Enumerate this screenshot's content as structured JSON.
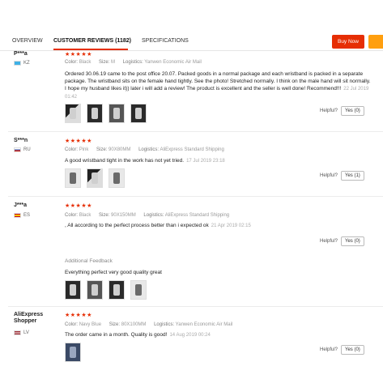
{
  "tabs": [
    {
      "label": "OVERVIEW"
    },
    {
      "label": "CUSTOMER REVIEWS (1182)"
    },
    {
      "label": "SPECIFICATIONS"
    }
  ],
  "buy_now_label": "Buy Now",
  "colors": {
    "accent": "#e62e04",
    "secondary": "#ff9f0f"
  },
  "stars": "★★★★★",
  "helpful_label": "Helpful?",
  "reviews": [
    {
      "name": "P***a",
      "country": "KZ",
      "meta": {
        "color_label": "Color:",
        "color": "Black",
        "size_label": "Size:",
        "size": "M",
        "logistics_label": "Logistics:",
        "logistics": "Yanwen Economic Air Mail"
      },
      "text": "Ordered 30.06.19 came to the post office 20.07. Packed goods in a normal package and each wristband is packed in a separate package. The wristband sits on the female hand tightly. See the photo! Stretched normally. I think on the male hand will sit normally. I hope my husband likes it)) later i will add a review! The product is excellent and the seller is well done! Recommend!!!",
      "date": "22 Jul 2019 01:42",
      "yes": "Yes (0)"
    },
    {
      "name": "S***n",
      "country": "RU",
      "meta": {
        "color_label": "Color:",
        "color": "Pink",
        "size_label": "Size:",
        "size": "90X80MM",
        "logistics_label": "Logistics:",
        "logistics": "AliExpress Standard Shipping"
      },
      "text": "A good wristband tight in the work has not yet tried.",
      "date": "17 Jul 2019 23:18",
      "yes": "Yes (1)"
    },
    {
      "name": "J***a",
      "country": "ES",
      "meta": {
        "color_label": "Color:",
        "color": "Black",
        "size_label": "Size:",
        "size": "90X150MM",
        "logistics_label": "Logistics:",
        "logistics": "AliExpress Standard Shipping"
      },
      "text": ", All according to the perfect process better than i expected ok",
      "date": "21 Apr 2019 02:15",
      "yes": "Yes (0)",
      "additional_label": "Additional Feedback",
      "additional_text": "Everything perfect very good quality great"
    },
    {
      "name": "AliExpress Shopper",
      "country": "LV",
      "meta": {
        "color_label": "Color:",
        "color": "Navy Blue",
        "size_label": "Size:",
        "size": "80X100MM",
        "logistics_label": "Logistics:",
        "logistics": "Yanwen Economic Air Mail"
      },
      "text": "The order came in a month. Quality is good!",
      "date": "14 Aug 2019 00:24",
      "yes": "Yes (0)"
    }
  ]
}
